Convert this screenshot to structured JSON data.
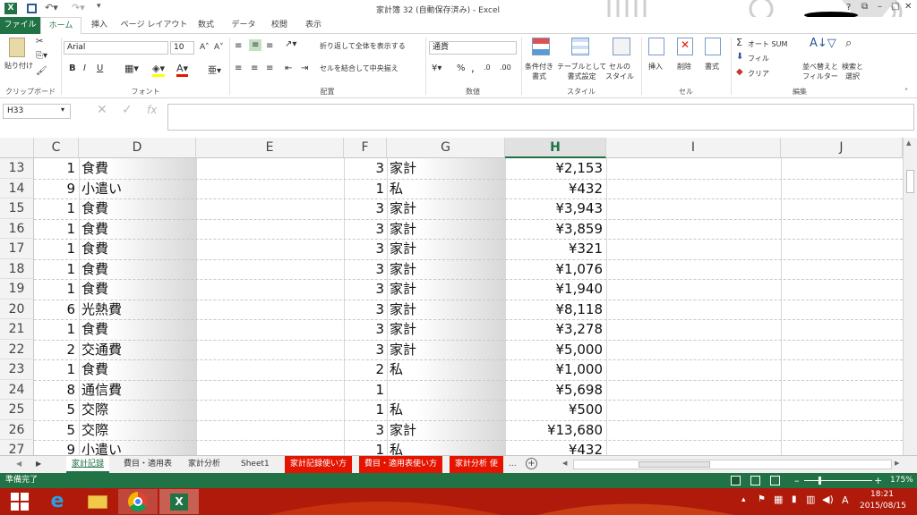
{
  "window": {
    "title": "家計簿 32 (自動保存済み) - Excel",
    "controls": [
      "?",
      "⧉",
      "–",
      "□",
      "✕"
    ]
  },
  "ribbon_tabs": [
    "ファイル",
    "ホーム",
    "挿入",
    "ページ レイアウト",
    "数式",
    "データ",
    "校閲",
    "表示"
  ],
  "clipboard": {
    "paste": "貼り付け",
    "label": "クリップボード"
  },
  "font": {
    "name": "Arial",
    "size": "10",
    "label": "フォント",
    "bold": "B",
    "italic": "I",
    "underline": "U",
    "grow": "A˄",
    "shrink": "A˅"
  },
  "alignment": {
    "wrap": "折り返して全体を表示する",
    "merge": "セルを結合して中央揃え",
    "label": "配置"
  },
  "number": {
    "format": "通貨",
    "label": "数値",
    "pct": "%",
    "comma": ","
  },
  "styles": {
    "cond": "条件付き\n書式",
    "table": "テーブルとして\n書式設定",
    "cell": "セルの\nスタイル",
    "label": "スタイル"
  },
  "cells_grp": {
    "insert": "挿入",
    "delete": "削除",
    "format": "書式",
    "label": "セル"
  },
  "editing": {
    "autosum": "オート SUM",
    "fill": "フィル",
    "clear": "クリア",
    "sort": "並べ替えと\nフィルター",
    "find": "検索と\n選択",
    "label": "編集"
  },
  "formula_bar": {
    "namebox": "H33",
    "fx": "fx",
    "value": ""
  },
  "columns": [
    "C",
    "D",
    "E",
    "F",
    "G",
    "H",
    "I",
    "J"
  ],
  "rows": [
    {
      "num": "13",
      "c": "1",
      "d": "食費",
      "f": "3",
      "g": "家計",
      "h": "¥2,153"
    },
    {
      "num": "14",
      "c": "9",
      "d": "小遣い",
      "f": "1",
      "g": "私",
      "h": "¥432"
    },
    {
      "num": "15",
      "c": "1",
      "d": "食費",
      "f": "3",
      "g": "家計",
      "h": "¥3,943"
    },
    {
      "num": "16",
      "c": "1",
      "d": "食費",
      "f": "3",
      "g": "家計",
      "h": "¥3,859"
    },
    {
      "num": "17",
      "c": "1",
      "d": "食費",
      "f": "3",
      "g": "家計",
      "h": "¥321"
    },
    {
      "num": "18",
      "c": "1",
      "d": "食費",
      "f": "3",
      "g": "家計",
      "h": "¥1,076"
    },
    {
      "num": "19",
      "c": "1",
      "d": "食費",
      "f": "3",
      "g": "家計",
      "h": "¥1,940"
    },
    {
      "num": "20",
      "c": "6",
      "d": "光熱費",
      "f": "3",
      "g": "家計",
      "h": "¥8,118"
    },
    {
      "num": "21",
      "c": "1",
      "d": "食費",
      "f": "3",
      "g": "家計",
      "h": "¥3,278"
    },
    {
      "num": "22",
      "c": "2",
      "d": "交通費",
      "f": "3",
      "g": "家計",
      "h": "¥5,000"
    },
    {
      "num": "23",
      "c": "1",
      "d": "食費",
      "f": "2",
      "g": "私",
      "h": "¥1,000"
    },
    {
      "num": "24",
      "c": "8",
      "d": "通信費",
      "f": "1",
      "g": "",
      "h": "¥5,698"
    },
    {
      "num": "25",
      "c": "5",
      "d": "交際",
      "f": "1",
      "g": "私",
      "h": "¥500"
    },
    {
      "num": "26",
      "c": "5",
      "d": "交際",
      "f": "3",
      "g": "家計",
      "h": "¥13,680"
    },
    {
      "num": "27",
      "c": "9",
      "d": "小遣い",
      "f": "1",
      "g": "私",
      "h": "¥432"
    }
  ],
  "sheets": [
    {
      "name": "家計記録",
      "active": true,
      "red": false
    },
    {
      "name": "費目・適用表",
      "active": false,
      "red": false
    },
    {
      "name": "家計分析",
      "active": false,
      "red": false
    },
    {
      "name": "Sheet1",
      "active": false,
      "red": false
    },
    {
      "name": "家計記録使い方",
      "active": false,
      "red": true
    },
    {
      "name": "費目・適用表使い方",
      "active": false,
      "red": true
    },
    {
      "name": "家計分析 使",
      "active": false,
      "red": true
    }
  ],
  "sheet_more": "...",
  "status": {
    "text": "準備完了",
    "zoom": "175%"
  },
  "taskbar": {
    "time": "18:21",
    "date": "2015/08/15",
    "ime": "A"
  },
  "colors": {
    "excel_green": "#217346",
    "taskbar": "#b01a0a",
    "sheet_red": "#e51400"
  }
}
